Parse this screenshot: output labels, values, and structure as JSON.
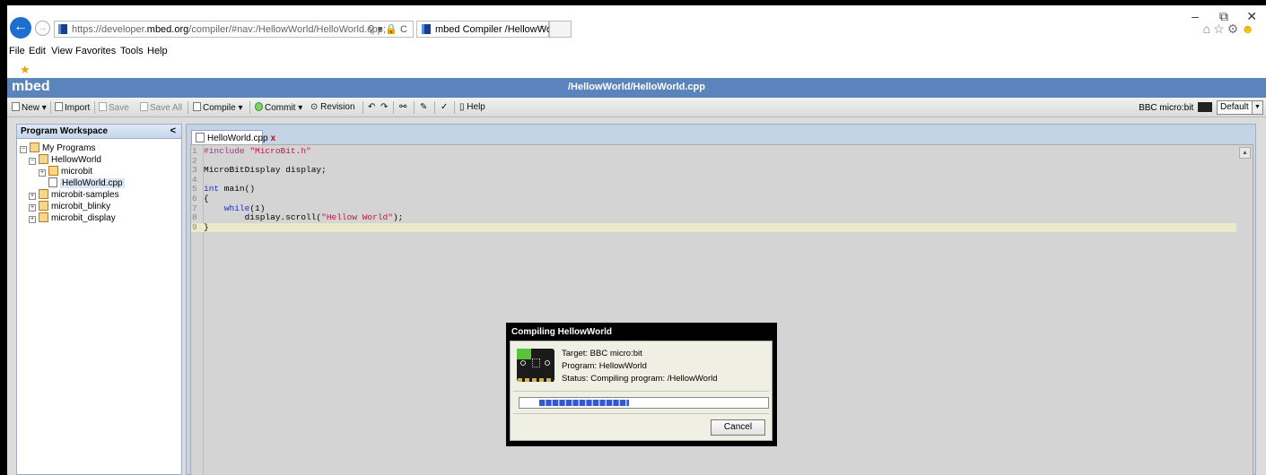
{
  "browser": {
    "url_prefix": "https://developer.",
    "url_host": "mbed.org",
    "url_path": "/compiler/#nav:/HellowWorld/HelloWorld.cpp;",
    "address_tools": "⚲ ▾ 🔒 C",
    "tab_title": "mbed Compiler /HellowWo...",
    "tab_close": "×",
    "window_controls": {
      "minimize": "–",
      "restore": "⧉",
      "close": "✕"
    },
    "toolbar_icons": [
      "home-icon",
      "star-icon",
      "gear-icon",
      "smiley-icon"
    ]
  },
  "menu": [
    "File",
    "Edit",
    "View",
    "Favorites",
    "Tools",
    "Help"
  ],
  "app": {
    "logo": "mbed",
    "path": "/HellowWorld/HelloWorld.cpp"
  },
  "toolbar": {
    "new": "New",
    "import": "Import",
    "save": "Save",
    "save_all": "Save All",
    "compile": "Compile",
    "commit": "Commit",
    "revision": "Revision",
    "help": "Help",
    "target_label": "BBC micro:bit",
    "target_select": "Default"
  },
  "sidebar": {
    "title": "Program Workspace",
    "collapse": "<",
    "tree": [
      {
        "label": "My Programs",
        "expander": "−"
      },
      {
        "label": "HellowWorld",
        "expander": "−"
      },
      {
        "label": "microbit",
        "expander": "+"
      },
      {
        "label": "HelloWorld.cpp",
        "expander": "",
        "selected": true
      },
      {
        "label": "microbit-samples",
        "expander": "+"
      },
      {
        "label": "microbit_blinky",
        "expander": "+"
      },
      {
        "label": "microbit_display",
        "expander": "+"
      }
    ]
  },
  "editor": {
    "tab_label": "HelloWorld.cpp",
    "tab_close": "x",
    "lines": [
      {
        "num": "1",
        "text": "#include \"MicroBit.h\""
      },
      {
        "num": "2",
        "text": ""
      },
      {
        "num": "3",
        "text": "MicroBitDisplay display;"
      },
      {
        "num": "4",
        "text": ""
      },
      {
        "num": "5",
        "text": "int main()"
      },
      {
        "num": "6",
        "text": "{"
      },
      {
        "num": "7",
        "text": "    while(1)"
      },
      {
        "num": "8",
        "text": "        display.scroll(\"Hellow World\");"
      },
      {
        "num": "9",
        "text": "}"
      }
    ],
    "scroll_up": "▲"
  },
  "dialog": {
    "title": "Compiling HellowWorld",
    "target": "Target: BBC micro:bit",
    "program": "Program: HellowWorld",
    "status": "Status: Compiling program: /HellowWorld",
    "progress": 0.36,
    "cancel": "Cancel"
  }
}
